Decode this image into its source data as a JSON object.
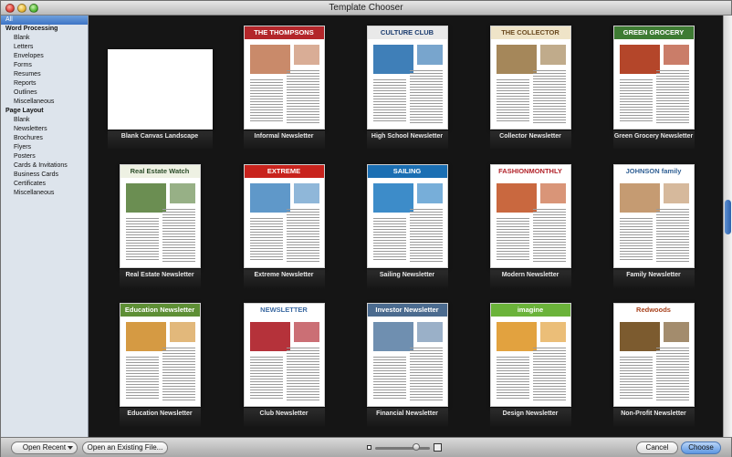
{
  "window": {
    "title": "Template Chooser"
  },
  "sidebar": {
    "all": "All",
    "groups": [
      {
        "title": "Word Processing",
        "items": [
          "Blank",
          "Letters",
          "Envelopes",
          "Forms",
          "Resumes",
          "Reports",
          "Outlines",
          "Miscellaneous"
        ]
      },
      {
        "title": "Page Layout",
        "items": [
          "Blank",
          "Newsletters",
          "Brochures",
          "Flyers",
          "Posters",
          "Cards & Invitations",
          "Business Cards",
          "Certificates",
          "Miscellaneous"
        ]
      }
    ]
  },
  "templates": [
    {
      "label": "Blank Canvas Landscape",
      "masthead": "",
      "accent": "#ffffff",
      "text": "#000000",
      "photo": "#ffffff"
    },
    {
      "label": "Informal Newsletter",
      "masthead": "THE THOMPSONS",
      "accent": "#b3262a",
      "text": "#ffffff",
      "photo": "#c98a6a"
    },
    {
      "label": "High School Newsletter",
      "masthead": "CULTURE CLUB",
      "accent": "#e9e9e9",
      "text": "#1a3b6e",
      "photo": "#3f7fb8"
    },
    {
      "label": "Collector Newsletter",
      "masthead": "THE COLLECTOR",
      "accent": "#efe4c8",
      "text": "#6b4a20",
      "photo": "#a5875a"
    },
    {
      "label": "Green Grocery Newsletter",
      "masthead": "GREEN GROCERY",
      "accent": "#3e7b33",
      "text": "#ffffff",
      "photo": "#b4462a"
    },
    {
      "label": "Real Estate Newsletter",
      "masthead": "Real Estate Watch",
      "accent": "#eef1e3",
      "text": "#2c4d2a",
      "photo": "#6b8e52"
    },
    {
      "label": "Extreme Newsletter",
      "masthead": "EXTREME",
      "accent": "#c8231d",
      "text": "#ffffff",
      "photo": "#5f98c9"
    },
    {
      "label": "Sailing Newsletter",
      "masthead": "SAILING",
      "accent": "#1b6fb3",
      "text": "#ffffff",
      "photo": "#3d8cc9"
    },
    {
      "label": "Modern Newsletter",
      "masthead": "FASHIONMONTHLY",
      "accent": "#ffffff",
      "text": "#b2232a",
      "photo": "#c9683f"
    },
    {
      "label": "Family Newsletter",
      "masthead": "JOHNSON family",
      "accent": "#ffffff",
      "text": "#2f5f94",
      "photo": "#c59b72"
    },
    {
      "label": "Education Newsletter",
      "masthead": "Education Newsletter",
      "accent": "#5e8f35",
      "text": "#ffffff",
      "photo": "#d59a43"
    },
    {
      "label": "Club Newsletter",
      "masthead": "NEWSLETTER",
      "accent": "#ffffff",
      "text": "#3c6aa2",
      "photo": "#b5323a"
    },
    {
      "label": "Financial Newsletter",
      "masthead": "Investor Newsletter",
      "accent": "#4b6b8f",
      "text": "#ffffff",
      "photo": "#6f8fb0"
    },
    {
      "label": "Design Newsletter",
      "masthead": "imagine",
      "accent": "#6bb33a",
      "text": "#ffffff",
      "photo": "#e2a23f"
    },
    {
      "label": "Non-Profit Newsletter",
      "masthead": "Redwoods",
      "accent": "#ffffff",
      "text": "#a8431e",
      "photo": "#7c5b2f"
    }
  ],
  "footer": {
    "open_recent": "Open Recent",
    "open_existing": "Open an Existing File...",
    "cancel": "Cancel",
    "choose": "Choose"
  }
}
